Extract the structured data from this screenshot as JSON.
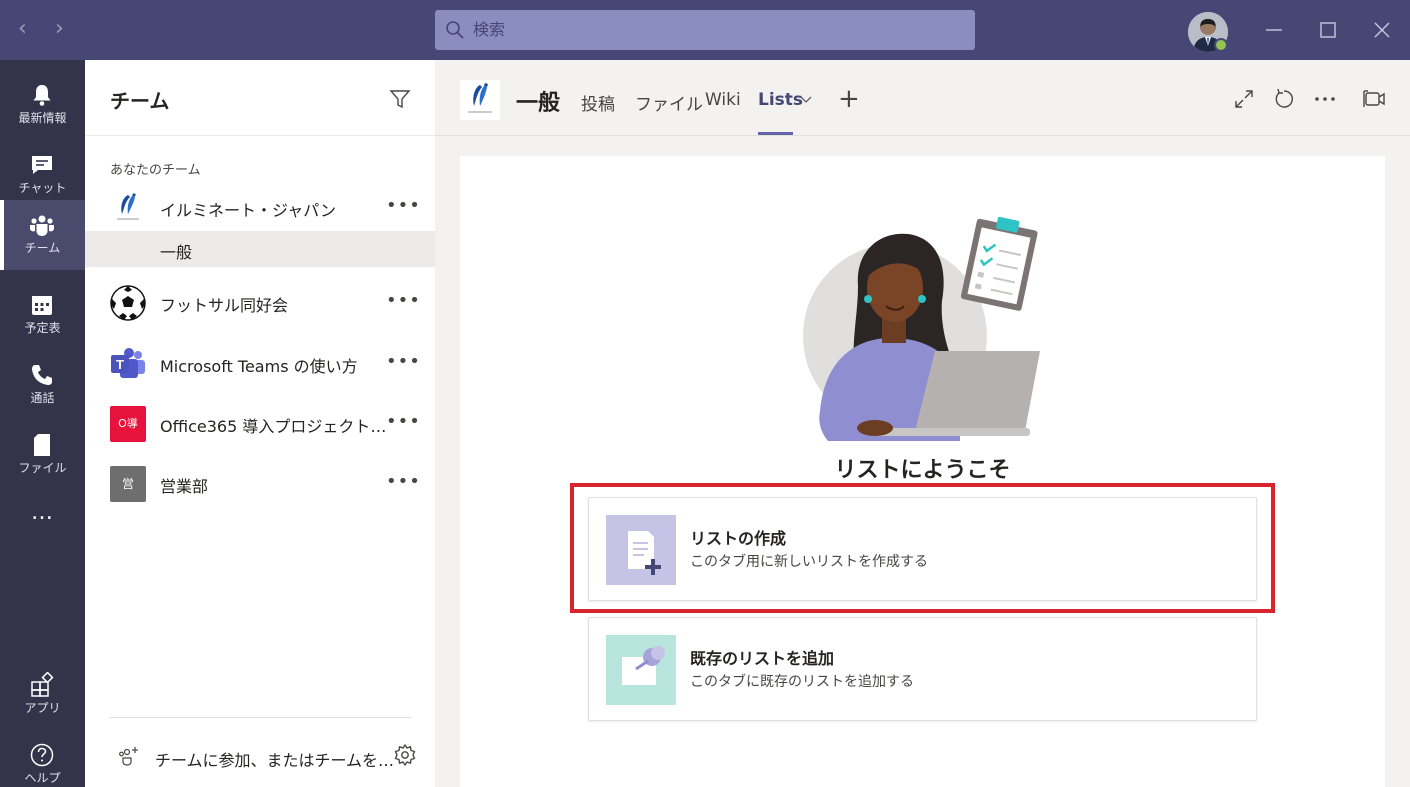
{
  "search": {
    "placeholder": "検索"
  },
  "rail": {
    "items": [
      {
        "label": "最新情報",
        "icon": "bell-icon"
      },
      {
        "label": "チャット",
        "icon": "chat-icon"
      },
      {
        "label": "チーム",
        "icon": "teams-icon",
        "active": true
      },
      {
        "label": "予定表",
        "icon": "calendar-icon"
      },
      {
        "label": "通話",
        "icon": "phone-icon"
      },
      {
        "label": "ファイル",
        "icon": "file-icon"
      }
    ],
    "more": "…",
    "apps_label": "アプリ",
    "help_label": "ヘルプ"
  },
  "panel": {
    "title": "チーム",
    "section_label": "あなたのチーム",
    "teams": [
      {
        "name": "イルミネート・ジャパン",
        "more": "•••"
      },
      {
        "name": "フットサル同好会",
        "more": "•••"
      },
      {
        "name": "Microsoft Teams の使い方",
        "more": "•••"
      },
      {
        "name": "Office365 導入プロジェクト…",
        "more": "•••"
      },
      {
        "name": "営業部",
        "more": "•••"
      }
    ],
    "active_channel": "一般",
    "icon_texts": {
      "office": "O導",
      "sales": "営"
    },
    "footer_join": "チームに参加、またはチームを…"
  },
  "header": {
    "channel_name": "一般",
    "tabs": [
      "投稿",
      "ファイル",
      "Wiki",
      "Lists"
    ],
    "active_tab": "Lists",
    "add_tab": "+"
  },
  "content": {
    "welcome": "リストにようこそ",
    "cards": [
      {
        "title": "リストの作成",
        "desc": "このタブ用に新しいリストを作成する"
      },
      {
        "title": "既存のリストを追加",
        "desc": "このタブに既存のリストを追加する"
      }
    ]
  },
  "colors": {
    "titlebar": "#464775",
    "rail": "#33344a",
    "accent": "#6264a7",
    "highlight": "#d9232d"
  }
}
